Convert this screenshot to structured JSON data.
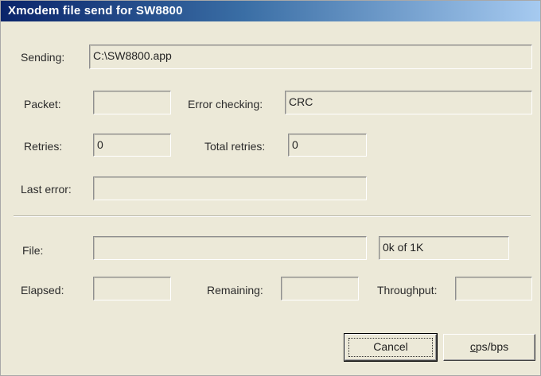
{
  "window": {
    "title": "Xmodem file send for SW8800"
  },
  "fields": {
    "sending": {
      "label": "Sending:",
      "value": "C:\\SW8800.app"
    },
    "packet": {
      "label": "Packet:",
      "value": ""
    },
    "error_checking": {
      "label": "Error checking:",
      "value": "CRC"
    },
    "retries": {
      "label": "Retries:",
      "value": "0"
    },
    "total_retries": {
      "label": "Total retries:",
      "value": "0"
    },
    "last_error": {
      "label": "Last error:",
      "value": ""
    },
    "file": {
      "label": "File:",
      "progress_percent": 0,
      "size_text": "0k of 1K"
    },
    "elapsed": {
      "label": "Elapsed:",
      "value": ""
    },
    "remaining": {
      "label": "Remaining:",
      "value": ""
    },
    "throughput": {
      "label": "Throughput:",
      "value": ""
    }
  },
  "buttons": {
    "cancel": "Cancel",
    "cps_bps_first": "c",
    "cps_bps_rest": "ps/bps"
  }
}
